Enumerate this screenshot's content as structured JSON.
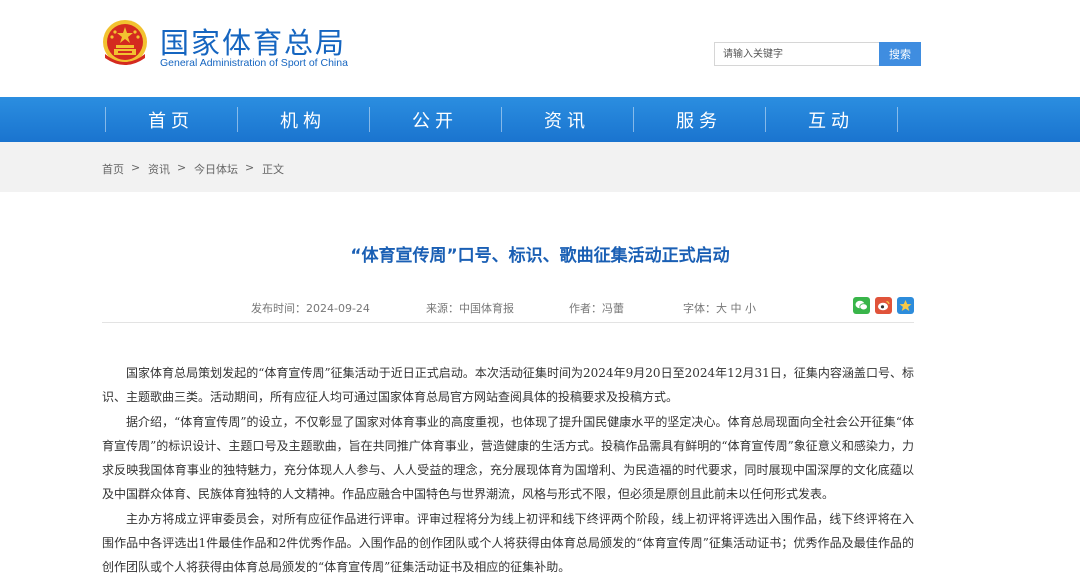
{
  "header": {
    "site_title": "国家体育总局",
    "site_subtitle": "General Administration of Sport of China",
    "search_placeholder": "请输入关键字",
    "search_button": "搜索"
  },
  "nav": {
    "items": [
      "首页",
      "机构",
      "公开",
      "资讯",
      "服务",
      "互动"
    ]
  },
  "breadcrumb": {
    "items": [
      "首页",
      "资讯",
      "今日体坛",
      "正文"
    ],
    "separator": ">"
  },
  "article": {
    "title": "“体育宣传周”口号、标识、歌曲征集活动正式启动",
    "publish_time": "发布时间：2024-09-24",
    "source": "来源：中国体育报",
    "author": "作者：冯蕾",
    "font_size_label": "字体：大 中 小",
    "paragraphs": [
      "国家体育总局策划发起的“体育宣传周”征集活动于近日正式启动。本次活动征集时间为2024年9月20日至2024年12月31日，征集内容涵盖口号、标识、主题歌曲三类。活动期间，所有应征人均可通过国家体育总局官方网站查阅具体的投稿要求及投稿方式。",
      "据介绍，“体育宣传周”的设立，不仅彰显了国家对体育事业的高度重视，也体现了提升国民健康水平的坚定决心。体育总局现面向全社会公开征集“体育宣传周”的标识设计、主题口号及主题歌曲，旨在共同推广体育事业，营造健康的生活方式。投稿作品需具有鲜明的“体育宣传周”象征意义和感染力，力求反映我国体育事业的独特魅力，充分体现人人参与、人人受益的理念，充分展现体育为国增利、为民造福的时代要求，同时展现中国深厚的文化底蕴以及中国群众体育、民族体育独特的人文精神。作品应融合中国特色与世界潮流，风格与形式不限，但必须是原创且此前未以任何形式发表。",
      "主办方将成立评审委员会，对所有应征作品进行评审。评审过程将分为线上初评和线下终评两个阶段，线上初评将评选出入围作品，线下终评将在入围作品中各评选出1件最佳作品和2件优秀作品。入围作品的创作团队或个人将获得由体育总局颁发的“体育宣传周”征集活动证书；优秀作品及最佳作品的创作团队或个人将获得由体育总局颁发的“体育宣传周”征集活动证书及相应的征集补助。"
    ]
  },
  "share_icons": [
    "wechat-icon",
    "weibo-icon",
    "qzone-icon"
  ],
  "colors": {
    "brand_blue": "#1565c0",
    "nav_blue": "#1f7fd8",
    "search_button": "#3f8de0",
    "title_blue": "#1a5fb4",
    "emblem_red": "#d42a1f",
    "emblem_gold": "#f2c230"
  }
}
